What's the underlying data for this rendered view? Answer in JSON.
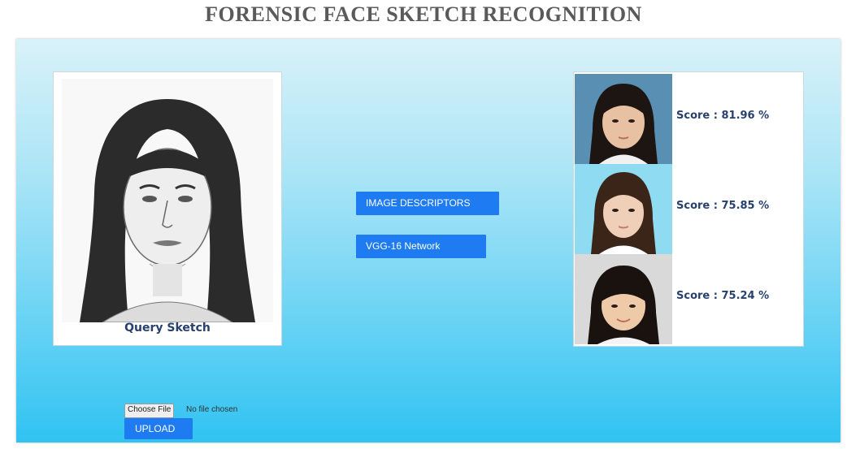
{
  "page": {
    "title": "FORENSIC FACE SKETCH RECOGNITION"
  },
  "query": {
    "label": "Query Sketch"
  },
  "methods": {
    "image_descriptors_label": "IMAGE DESCRIPTORS",
    "vgg16_label": "VGG-16 Network"
  },
  "results": [
    {
      "score": "Score : 81.96 %"
    },
    {
      "score": "Score : 75.85 %"
    },
    {
      "score": "Score : 75.24 %"
    }
  ],
  "upload": {
    "choose_file_label": "Choose File",
    "no_file_text": "No file chosen",
    "upload_label": "UPLOAD"
  },
  "colors": {
    "button_blue": "#1e7bf2",
    "score_text": "#27406e",
    "panel_top": "#d9f2f9",
    "panel_bottom": "#30c3f2"
  },
  "icons": [
    "query-sketch-image",
    "match-photo-1",
    "match-photo-2",
    "match-photo-3"
  ]
}
